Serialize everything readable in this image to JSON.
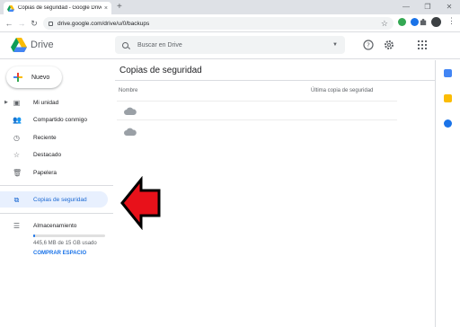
{
  "browser": {
    "tab_title": "Copias de seguridad - Google Drive",
    "tab_close": "×",
    "new_tab": "+",
    "url": "drive.google.com/drive/u/0/backups",
    "window_controls": [
      "—",
      "❐",
      "✕"
    ]
  },
  "drive": {
    "brand": "Drive",
    "search_placeholder": "Buscar en Drive",
    "new_button": "Nuevo",
    "nav": [
      {
        "label": "Mi unidad",
        "icon": "my-drive-icon"
      },
      {
        "label": "Compartido conmigo",
        "icon": "shared-icon"
      },
      {
        "label": "Reciente",
        "icon": "clock-icon"
      },
      {
        "label": "Destacado",
        "icon": "star-icon"
      },
      {
        "label": "Papelera",
        "icon": "trash-icon"
      }
    ],
    "backups_label": "Copias de seguridad",
    "storage_label": "Almacenamiento",
    "storage_used": "445,6 MB de 15 GB usado",
    "storage_fraction": 0.03,
    "buy_storage": "COMPRAR ESPACIO",
    "page_title": "Copias de seguridad",
    "columns": {
      "name": "Nombre",
      "last_backup": "Última copia de seguridad"
    },
    "rows": [
      {
        "icon": "cloud-icon"
      },
      {
        "icon": "cloud-icon"
      }
    ]
  },
  "colors": {
    "accent": "#1a73e8",
    "active_bg": "#e8f0fe",
    "arrow": "#e8111a"
  }
}
